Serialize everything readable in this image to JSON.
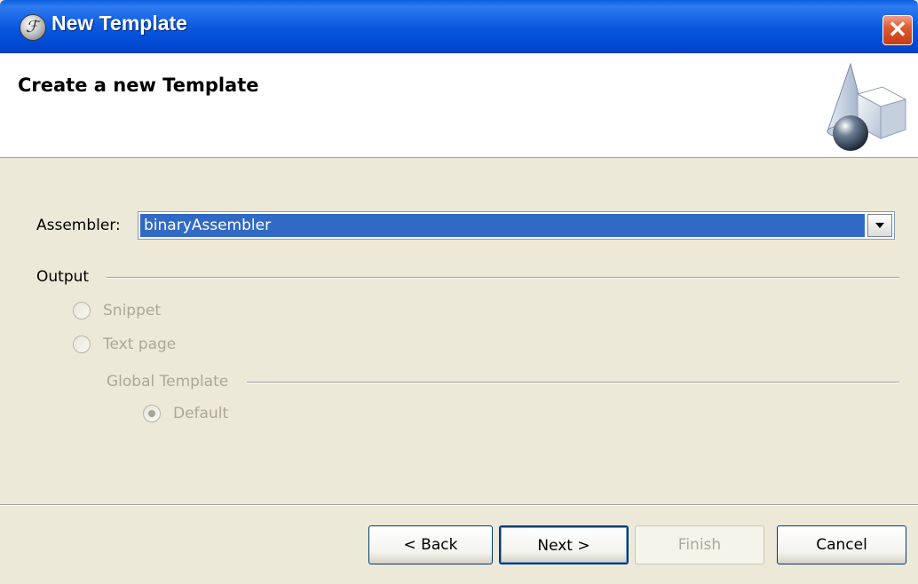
{
  "window": {
    "title": "New Template",
    "close_glyph": "✕"
  },
  "header": {
    "title": "Create a new Template",
    "graphic_icon": "shapes-wizard-icon"
  },
  "form": {
    "assembler_label": "Assembler:",
    "assembler_value": "binaryAssembler",
    "output_group_label": "Output",
    "output_options": [
      {
        "label": "Snippet",
        "selected": false,
        "enabled": false
      },
      {
        "label": "Text page",
        "selected": false,
        "enabled": false
      }
    ],
    "global_template_label": "Global Template",
    "global_template_options": [
      {
        "label": "Default",
        "selected": true,
        "enabled": false
      }
    ]
  },
  "buttons": {
    "back": "< Back",
    "next": "Next >",
    "finish": "Finish",
    "cancel": "Cancel"
  },
  "colors": {
    "titlebar": "#0a5fe0",
    "dialog_bg": "#ece9d8",
    "selection": "#316ac5",
    "disabled_text": "#aca899"
  }
}
